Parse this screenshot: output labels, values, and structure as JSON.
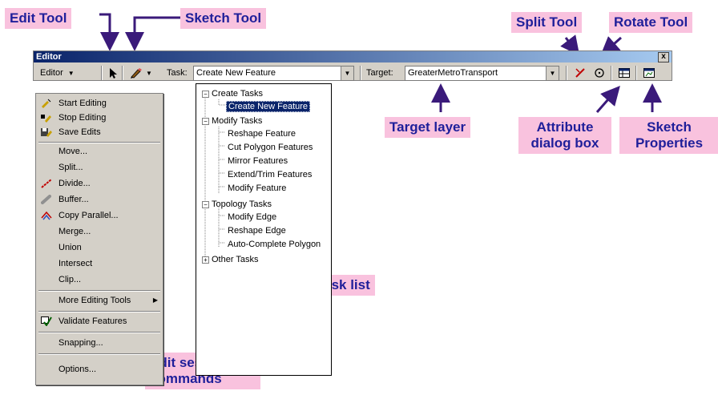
{
  "callouts": {
    "edit_tool": "Edit Tool",
    "sketch_tool": "Sketch Tool",
    "split_tool": "Split Tool",
    "rotate_tool": "Rotate Tool",
    "target_layer": "Target layer",
    "attribute_dialog": "Attribute\ndialog box",
    "sketch_properties": "Sketch\nProperties",
    "task_list": "Task list",
    "edit_session": "Edit session\ncommands"
  },
  "window": {
    "title": "Editor",
    "close": "x"
  },
  "toolbar": {
    "editor_menu": "Editor",
    "task_label": "Task:",
    "task_value": "Create New Feature",
    "target_label": "Target:",
    "target_value": "GreaterMetroTransport"
  },
  "menu": {
    "items": [
      "Start Editing",
      "Stop Editing",
      "Save Edits",
      "Move...",
      "Split...",
      "Divide...",
      "Buffer...",
      "Copy Parallel...",
      "Merge...",
      "Union",
      "Intersect",
      "Clip...",
      "More Editing Tools",
      "Validate Features",
      "Snapping...",
      "Options..."
    ]
  },
  "tasks": {
    "groups": [
      "Create Tasks",
      "Modify Tasks",
      "Topology Tasks",
      "Other Tasks"
    ],
    "create": [
      "Create New Feature"
    ],
    "modify": [
      "Reshape Feature",
      "Cut Polygon Features",
      "Mirror Features",
      "Extend/Trim Features",
      "Modify Feature"
    ],
    "topology": [
      "Modify Edge",
      "Reshape Edge",
      "Auto-Complete Polygon"
    ]
  },
  "colors": {
    "callout_bg": "#f9c2de",
    "callout_text": "#1f1f9a",
    "arrow": "#3a1a7a",
    "titlebar": "#0a246a"
  }
}
